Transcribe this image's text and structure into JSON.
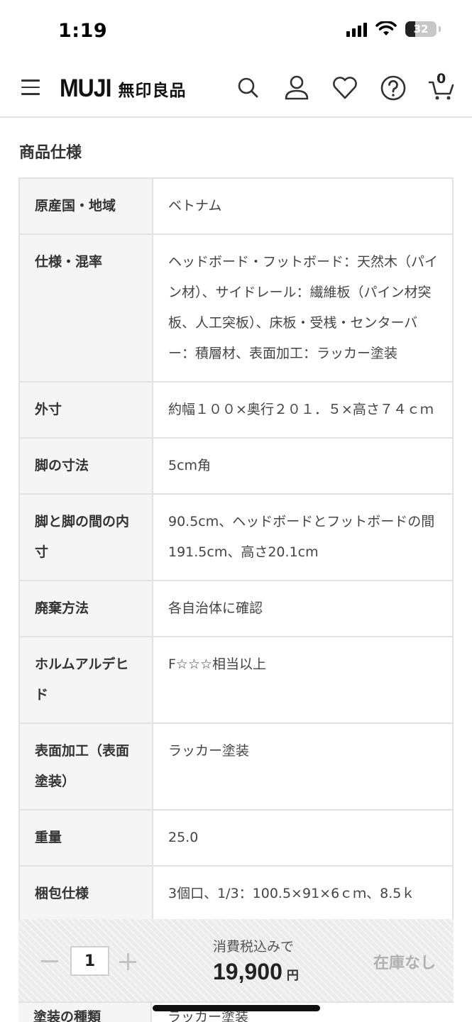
{
  "status_bar": {
    "time": "1:19",
    "battery": "32",
    "battery_level": 0.32
  },
  "header": {
    "logo_en": "MUJI",
    "logo_ja": "無印良品",
    "cart_count": "0",
    "icons": [
      "menu-icon",
      "search-icon",
      "account-icon",
      "heart-icon",
      "help-icon",
      "cart-icon"
    ]
  },
  "section": {
    "title": "商品仕様"
  },
  "specs": [
    {
      "key": "原産国・地域",
      "value": "ベトナム"
    },
    {
      "key": "仕様・混率",
      "value": "ヘッドボード・フットボード：天然木（パイン材）、サイドレール：繊維板（パイン材突板、人工突板）、床板・受桟・センターバー：積層材、表面加工：ラッカー塗装"
    },
    {
      "key": "外寸",
      "value": "約幅１００×奥行２０１．５×高さ７４ｃｍ"
    },
    {
      "key": "脚の寸法",
      "value": "5cm角"
    },
    {
      "key": "脚と脚の間の内寸",
      "value": "90.5cm、ヘッドボードとフットボードの間191.5cm、高さ20.1cm"
    },
    {
      "key": "廃棄方法",
      "value": "各自治体に確認"
    },
    {
      "key": "ホルムアルデヒド",
      "value": "F☆☆☆相当以上"
    },
    {
      "key": "表面加工（表面塗装）",
      "value": "ラッカー塗装"
    },
    {
      "key": "重量",
      "value": "25.0"
    },
    {
      "key": "梱包仕様",
      "value": "3個口、1/3：100.5×91×6ｃｍ、8.5ｋ"
    }
  ],
  "partial_row": {
    "key": "塗装の種類",
    "value": "ラッカー塗装"
  },
  "purchase_bar": {
    "quantity": "1",
    "tax_label": "消費税込みで",
    "price": "19,900",
    "currency": "円",
    "stock_status": "在庫なし"
  }
}
